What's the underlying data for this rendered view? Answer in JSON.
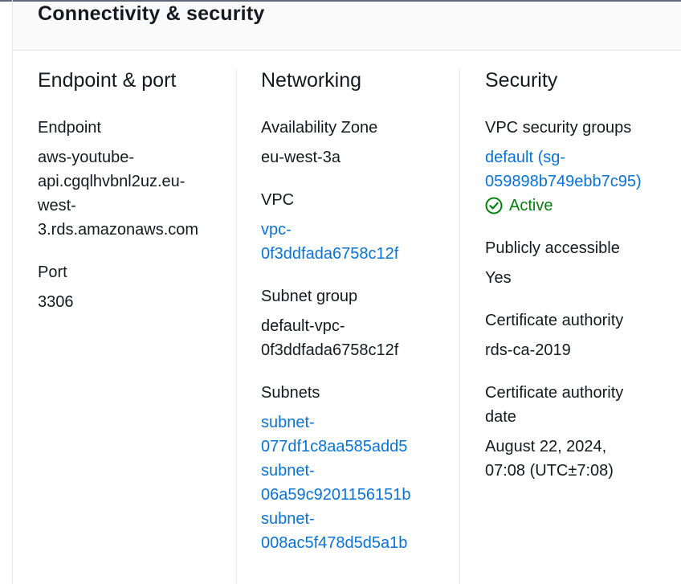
{
  "panel": {
    "title": "Connectivity & security"
  },
  "endpoint_port": {
    "title": "Endpoint & port",
    "endpoint_label": "Endpoint",
    "endpoint_lines": [
      "aws-youtube-",
      "api.cgqlhvbnl2uz.eu-",
      "west-",
      "3.rds.amazonaws.com"
    ],
    "port_label": "Port",
    "port_value": "3306"
  },
  "networking": {
    "title": "Networking",
    "az_label": "Availability Zone",
    "az_value": "eu-west-3a",
    "vpc_label": "VPC",
    "vpc_lines": [
      "vpc-",
      "0f3ddfada6758c12f"
    ],
    "subnet_group_label": "Subnet group",
    "subnet_group_lines": [
      "default-vpc-",
      "0f3ddfada6758c12f"
    ],
    "subnets_label": "Subnets",
    "subnets": [
      [
        "subnet-",
        "077df1c8aa585add5"
      ],
      [
        "subnet-",
        "06a59c9201156151b"
      ],
      [
        "subnet-",
        "008ac5f478d5d5a1b"
      ]
    ]
  },
  "security": {
    "title": "Security",
    "sg_label": "VPC security groups",
    "sg_lines": [
      "default (sg-",
      "059898b749ebb7c95)"
    ],
    "sg_status": "Active",
    "sg_status_color": "#037f0c",
    "public_label": "Publicly accessible",
    "public_value": "Yes",
    "ca_label": "Certificate authority",
    "ca_value": "rds-ca-2019",
    "ca_date_label_lines": [
      "Certificate authority",
      "date"
    ],
    "ca_date_lines": [
      "August 22, 2024,",
      "07:08 (UTC±7:08)"
    ]
  },
  "colors": {
    "link": "#0972d3",
    "text": "#16191f",
    "success": "#037f0c",
    "divider": "#e3e6ea",
    "header_bg": "#fafafa"
  },
  "icons": [
    "status-positive-icon"
  ]
}
